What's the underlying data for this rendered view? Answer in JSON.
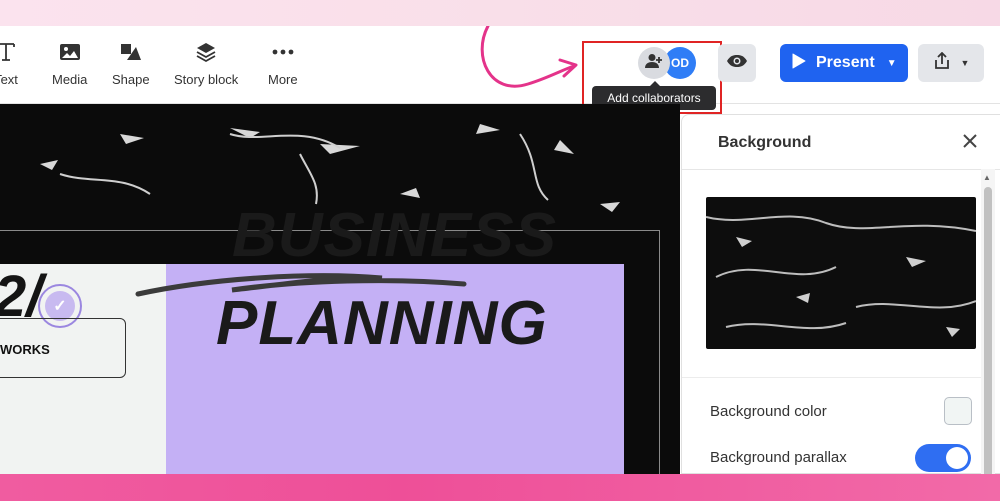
{
  "toolbar": {
    "tools": [
      {
        "label": "Text",
        "icon": "text-icon"
      },
      {
        "label": "Media",
        "icon": "image-icon"
      },
      {
        "label": "Shape",
        "icon": "shape-icon"
      },
      {
        "label": "Story block",
        "icon": "layers-icon"
      },
      {
        "label": "More",
        "icon": "more-dots-icon"
      }
    ],
    "collaborators": {
      "tooltip": "Add collaborators",
      "avatar_initials": "OD",
      "icon": "add-user-icon"
    },
    "preview_icon": "eye-icon",
    "present_label": "Present",
    "share_icon": "share-upload-icon"
  },
  "canvas": {
    "headline_line1": "BUSINESS",
    "headline_line2": "PLANNING",
    "big_number": "2/",
    "card_label": "WORKS"
  },
  "panel": {
    "title": "Background",
    "background_color_label": "Background color",
    "background_color_value": "#f1f5f4",
    "background_parallax_label": "Background parallax",
    "background_parallax_on": true
  },
  "colors": {
    "accent_blue": "#1f63f0",
    "highlight_red": "#e02424",
    "card_purple": "#c4b0f5",
    "band_pink": "#ee4f98"
  }
}
